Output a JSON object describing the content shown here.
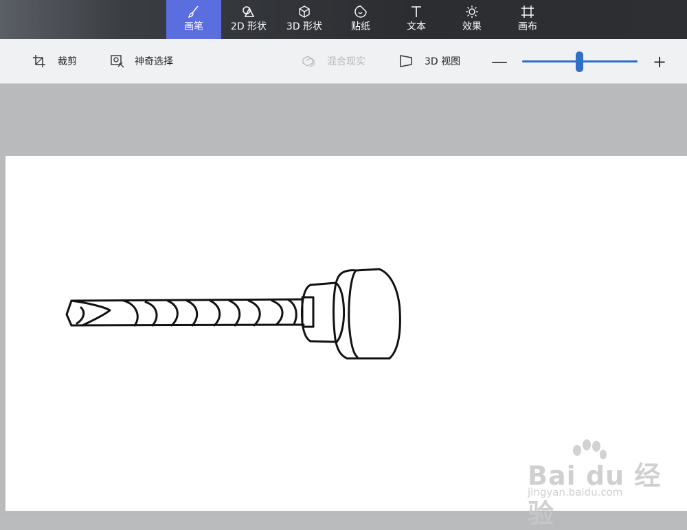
{
  "ribbon": {
    "tabs": [
      {
        "label": "画笔",
        "icon": "brush-icon",
        "active": true
      },
      {
        "label": "2D 形状",
        "icon": "shapes-2d-icon",
        "active": false
      },
      {
        "label": "3D 形状",
        "icon": "cube-3d-icon",
        "active": false
      },
      {
        "label": "贴纸",
        "icon": "sticker-icon",
        "active": false
      },
      {
        "label": "文本",
        "icon": "text-icon",
        "active": false
      },
      {
        "label": "效果",
        "icon": "effects-sun-icon",
        "active": false
      },
      {
        "label": "画布",
        "icon": "canvas-icon",
        "active": false
      }
    ],
    "active_color": "#5b6ee0"
  },
  "toolbar": {
    "crop_label": "裁剪",
    "magic_select_label": "神奇选择",
    "mixed_reality_label": "混合现实",
    "view_3d_label": "3D 视图",
    "zoom_minus": "—",
    "zoom_plus": "+",
    "zoom_level_fraction": 0.5,
    "accent": "#2f6fc8"
  },
  "watermark": {
    "brand": "Bai du 经验",
    "url": "jingyan.baidu.com"
  }
}
